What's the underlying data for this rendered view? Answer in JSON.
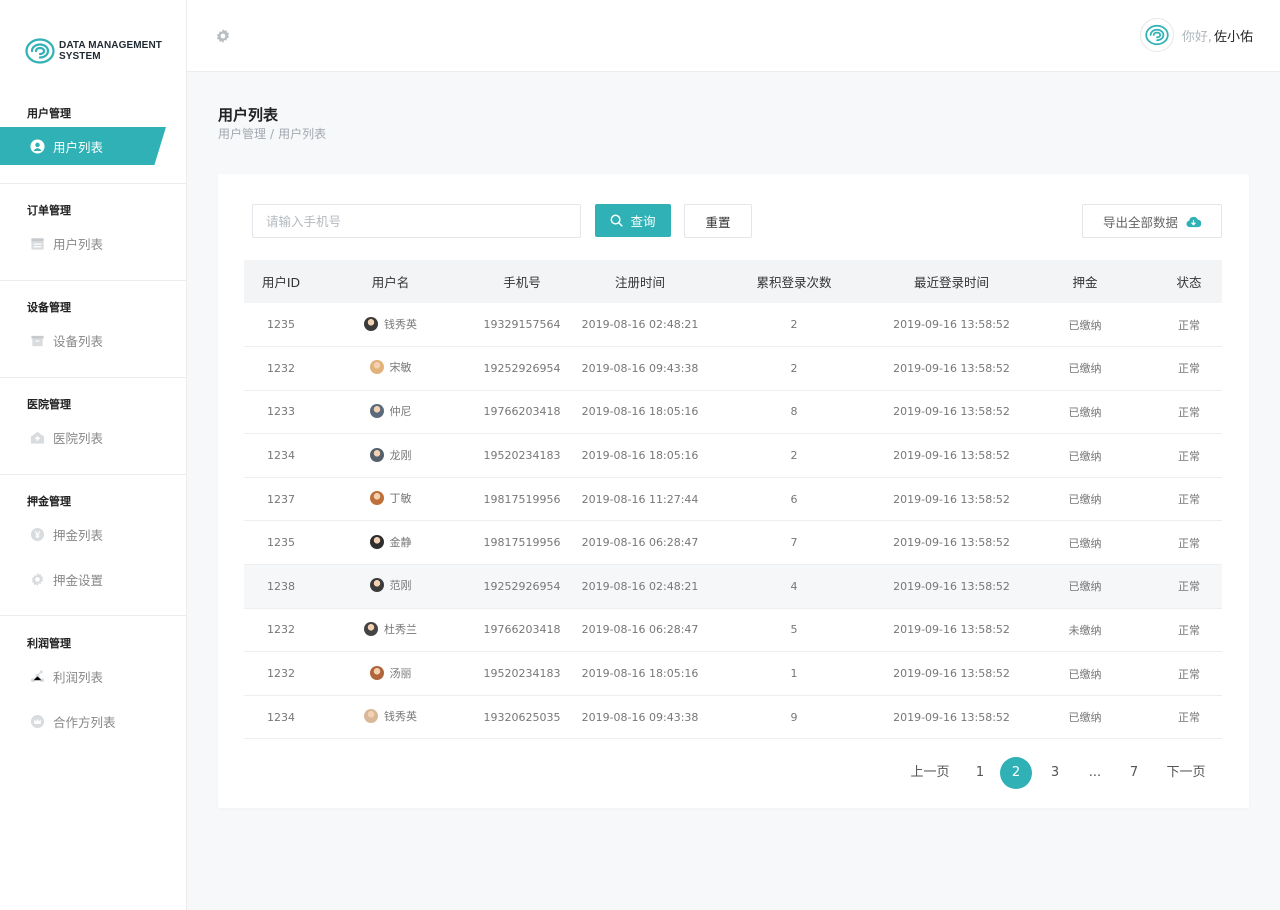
{
  "brand": {
    "line1": "DATA MANAGEMENT",
    "line2": "SYSTEM"
  },
  "sidebar": {
    "groups": [
      {
        "title": "用户管理",
        "items": [
          {
            "label": "用户列表",
            "icon": "user-circle-icon",
            "active": true
          }
        ]
      },
      {
        "title": "订单管理",
        "items": [
          {
            "label": "用户列表",
            "icon": "calendar-icon"
          }
        ]
      },
      {
        "title": "设备管理",
        "items": [
          {
            "label": "设备列表",
            "icon": "box-icon"
          }
        ]
      },
      {
        "title": "医院管理",
        "items": [
          {
            "label": "医院列表",
            "icon": "hospital-icon"
          }
        ]
      },
      {
        "title": "押金管理",
        "items": [
          {
            "label": "押金列表",
            "icon": "yen-coin-icon"
          },
          {
            "label": "押金设置",
            "icon": "gear-icon"
          }
        ]
      },
      {
        "title": "利润管理",
        "items": [
          {
            "label": "利润列表",
            "icon": "network-icon"
          },
          {
            "label": "合作方列表",
            "icon": "crown-icon"
          }
        ]
      }
    ]
  },
  "header": {
    "greeting": "你好,",
    "username": "佐小佑"
  },
  "page": {
    "title": "用户列表",
    "breadcrumb": [
      "用户管理",
      "/",
      "用户列表"
    ]
  },
  "toolbar": {
    "search_placeholder": "请输入手机号",
    "query_label": "查询",
    "reset_label": "重置",
    "export_label": "导出全部数据"
  },
  "table": {
    "columns": [
      "用户ID",
      "用户名",
      "手机号",
      "注册时间",
      "累积登录次数",
      "最近登录时间",
      "押金",
      "状态"
    ],
    "rows": [
      {
        "id": "1235",
        "name": "钱秀英",
        "phone": "19329157564",
        "registered": "2019-08-16 02:48:21",
        "logins": "2",
        "last_login": "2019-09-16 13:58:52",
        "deposit": "已缴纳",
        "status": "正常"
      },
      {
        "id": "1232",
        "name": "宋敏",
        "phone": "19252926954",
        "registered": "2019-08-16 09:43:38",
        "logins": "2",
        "last_login": "2019-09-16 13:58:52",
        "deposit": "已缴纳",
        "status": "正常"
      },
      {
        "id": "1233",
        "name": "仲尼",
        "phone": "19766203418",
        "registered": "2019-08-16 18:05:16",
        "logins": "8",
        "last_login": "2019-09-16 13:58:52",
        "deposit": "已缴纳",
        "status": "正常"
      },
      {
        "id": "1234",
        "name": "龙刚",
        "phone": "19520234183",
        "registered": "2019-08-16 18:05:16",
        "logins": "2",
        "last_login": "2019-09-16 13:58:52",
        "deposit": "已缴纳",
        "status": "正常"
      },
      {
        "id": "1237",
        "name": "丁敏",
        "phone": "19817519956",
        "registered": "2019-08-16 11:27:44",
        "logins": "6",
        "last_login": "2019-09-16 13:58:52",
        "deposit": "已缴纳",
        "status": "正常"
      },
      {
        "id": "1235",
        "name": "金静",
        "phone": "19817519956",
        "registered": "2019-08-16 06:28:47",
        "logins": "7",
        "last_login": "2019-09-16 13:58:52",
        "deposit": "已缴纳",
        "status": "正常"
      },
      {
        "id": "1238",
        "name": "范刚",
        "phone": "19252926954",
        "registered": "2019-08-16 02:48:21",
        "logins": "4",
        "last_login": "2019-09-16 13:58:52",
        "deposit": "已缴纳",
        "status": "正常"
      },
      {
        "id": "1232",
        "name": "杜秀兰",
        "phone": "19766203418",
        "registered": "2019-08-16 06:28:47",
        "logins": "5",
        "last_login": "2019-09-16 13:58:52",
        "deposit": "未缴纳",
        "status": "正常"
      },
      {
        "id": "1232",
        "name": "汤丽",
        "phone": "19520234183",
        "registered": "2019-08-16 18:05:16",
        "logins": "1",
        "last_login": "2019-09-16 13:58:52",
        "deposit": "已缴纳",
        "status": "正常"
      },
      {
        "id": "1234",
        "name": "钱秀英",
        "phone": "19320625035",
        "registered": "2019-08-16 09:43:38",
        "logins": "9",
        "last_login": "2019-09-16 13:58:52",
        "deposit": "已缴纳",
        "status": "正常"
      }
    ]
  },
  "pagination": {
    "prev_label": "上一页",
    "pages": [
      "1",
      "2",
      "3",
      "...",
      "7"
    ],
    "current": "2",
    "next_label": "下一页"
  },
  "colors": {
    "accent": "#2fb1b5",
    "paid": "#2a8a2a",
    "unpaid": "#d42a2a"
  }
}
